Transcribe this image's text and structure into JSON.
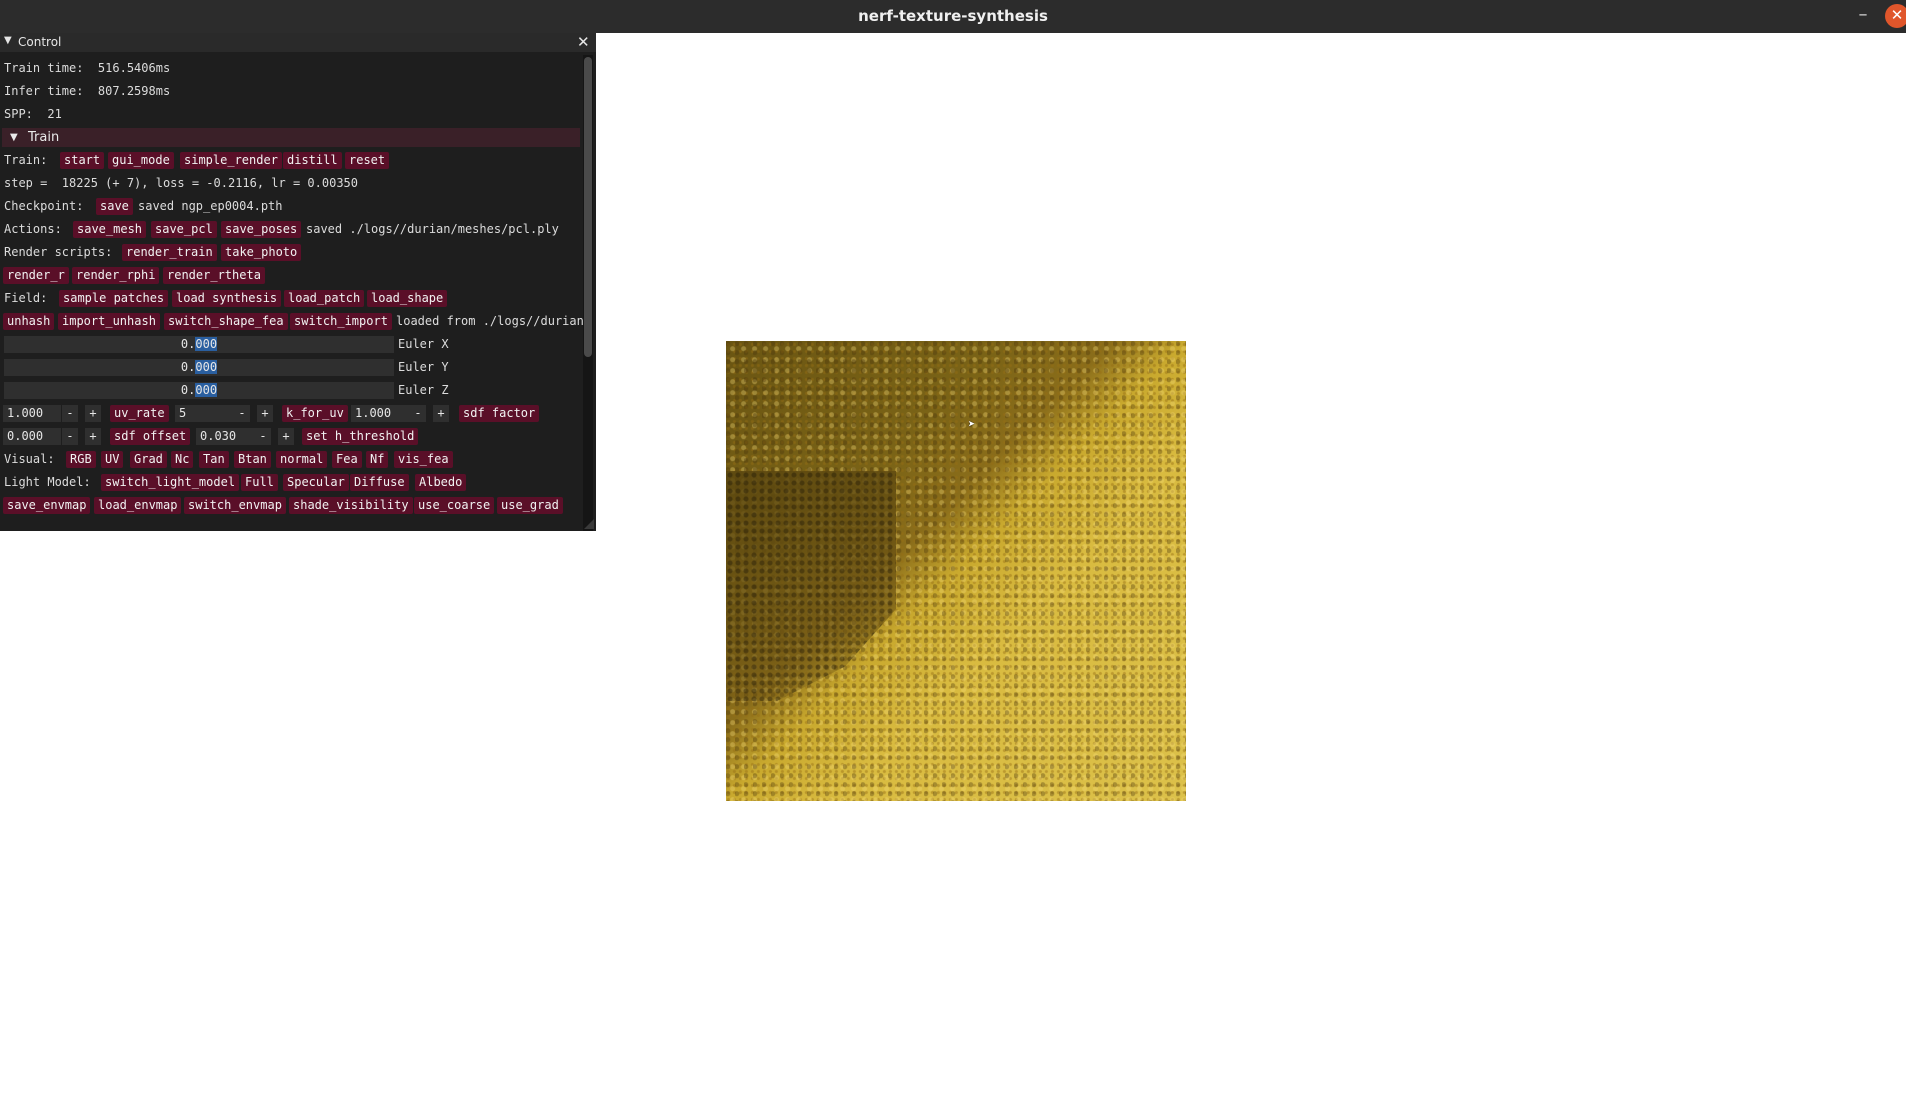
{
  "window": {
    "title": "nerf-texture-synthesis",
    "minimize_label": "–",
    "close_label": "✕"
  },
  "panel": {
    "title": "Control",
    "close_label": "✕",
    "train_time": "Train time:  516.5406ms",
    "infer_time": "Infer time:  807.2598ms",
    "spp": "SPP:  21",
    "section_train": "Train",
    "train_label": "Train:",
    "train_buttons": [
      "start",
      "gui_mode",
      "simple_render",
      "distill",
      "reset"
    ],
    "step_text": "step =  18225 (+ 7), loss = -0.2116, lr = 0.00350",
    "checkpoint_label": "Checkpoint:",
    "checkpoint_button": "save",
    "checkpoint_status": "saved ngp_ep0004.pth",
    "actions_label": "Actions:",
    "actions_buttons": [
      "save_mesh",
      "save_pcl",
      "save_poses"
    ],
    "actions_status": "saved ./logs//durian/meshes/pcl.ply",
    "render_scripts_label": "Render scripts:",
    "render_scripts_buttons": [
      "render_train",
      "take_photo"
    ],
    "render_buttons_2": [
      "render_r",
      "render_rphi",
      "render_rtheta"
    ],
    "field_label": "Field:",
    "field_buttons": [
      "sample patches",
      "load synthesis",
      "load_patch",
      "load_shape"
    ],
    "hash_buttons": [
      "unhash",
      "import_unhash",
      "switch_shape_fea",
      "switch_import"
    ],
    "hash_status": "loaded from ./logs//durian",
    "euler": [
      {
        "int": "0.",
        "sel": "000",
        "label": "Euler X"
      },
      {
        "int": "0.",
        "sel": "000",
        "label": "Euler Y"
      },
      {
        "int": "0.",
        "sel": "000",
        "label": "Euler Z"
      }
    ],
    "row_uv": {
      "value1": "1.000",
      "btn1": "uv_rate",
      "value2": "5",
      "btn2": "k_for_uv",
      "value3": "1.000",
      "btn3": "sdf factor"
    },
    "row_sdf": {
      "value1": "0.000",
      "btn1": "sdf offset",
      "value2": "0.030",
      "btn2": "set h_threshold"
    },
    "minus": "-",
    "plus": "+",
    "visual_label": "Visual:",
    "visual_buttons": [
      "RGB",
      "UV",
      "Grad",
      "Nc",
      "Tan",
      "Btan",
      "normal",
      "Fea",
      "Nf",
      "vis_fea"
    ],
    "light_label": "Light Model:",
    "light_buttons": [
      "switch_light_model",
      "Full",
      "Specular",
      "Diffuse",
      "Albedo"
    ],
    "env_buttons": [
      "save_envmap",
      "load_envmap",
      "switch_envmap",
      "shade_visibility",
      "use_coarse",
      "use_grad"
    ]
  },
  "colors": {
    "button": "#5a0f28",
    "panel_bg": "#1e1e1e",
    "titlebar": "#2c2c2c",
    "close": "#e0562b"
  }
}
